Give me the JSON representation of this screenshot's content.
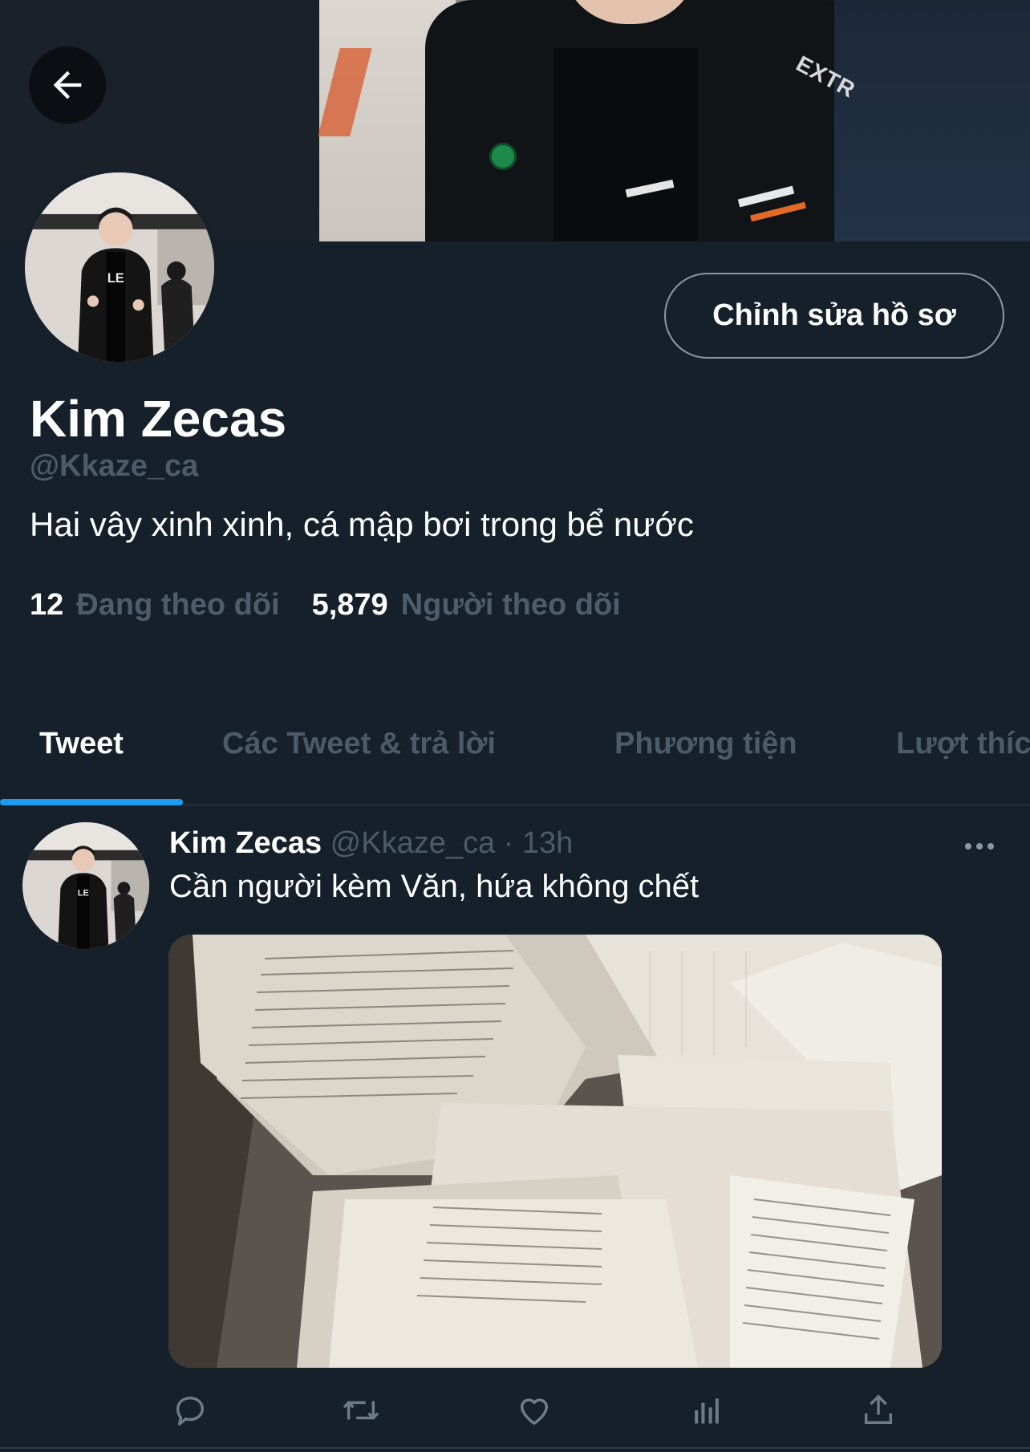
{
  "banner": {
    "brand_text": "EXTR"
  },
  "profile": {
    "edit_button_label": "Chỉnh sửa hồ sơ",
    "display_name": "Kim Zecas",
    "handle": "@Kkaze_ca",
    "bio": "Hai vây xinh xinh, cá mập bơi trong bể nước",
    "following_count": "12",
    "following_label": "Đang theo dõi",
    "followers_count": "5,879",
    "followers_label": "Người theo dõi"
  },
  "tabs": [
    {
      "label": "Tweet"
    },
    {
      "label": "Các Tweet & trả lời"
    },
    {
      "label": "Phương tiện"
    },
    {
      "label": "Lượt thích"
    }
  ],
  "tweet": {
    "name": "Kim Zecas",
    "meta": "@Kkaze_ca · 13h",
    "text": "Cần người kèm Văn, hứa không chết"
  },
  "icons": {
    "back": "arrow-left-icon",
    "more": "more-horizontal-icon",
    "reply": "reply-icon",
    "retweet": "retweet-icon",
    "like": "heart-icon",
    "views": "analytics-icon",
    "share": "share-icon"
  },
  "colors": {
    "background": "#15202b",
    "accent": "#1d9bf0",
    "muted_text": "#4d5a68",
    "border": "#2f3d4b"
  }
}
